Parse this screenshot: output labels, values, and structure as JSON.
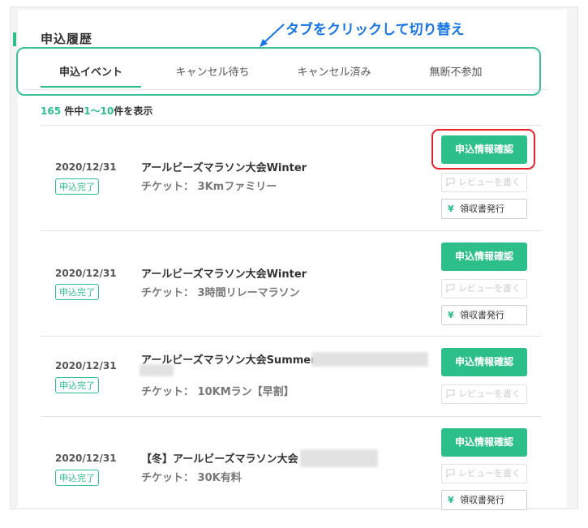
{
  "page": {
    "title": "申込履歴"
  },
  "annotation": {
    "text": "タブをクリックして切り替え",
    "color": "#1575e6"
  },
  "tabs": [
    {
      "label": "申込イベント",
      "active": true
    },
    {
      "label": "キャンセル待ち",
      "active": false
    },
    {
      "label": "キャンセル済み",
      "active": false
    },
    {
      "label": "無断不参加",
      "active": false
    }
  ],
  "count": {
    "total": "165",
    "suffix1": " 件中",
    "range_start": "1",
    "range_sep": "〜",
    "range_end": "10",
    "suffix2": "件を表示"
  },
  "theme": {
    "accent": "#2dbf89",
    "highlight_ring": "#e8202a"
  },
  "buttons": {
    "detail_label": "申込情報確認",
    "review_label": "レビューを書く",
    "receipt_label": "領収書発行",
    "review_icon": "speech-bubble-icon",
    "receipt_icon": "yen-icon"
  },
  "applications": [
    {
      "date": "2020/12/31",
      "status": "申込完了",
      "title": "アールビーズマラソン大会Winter",
      "ticket": "チケット： 3Kmファミリー",
      "has_receipt": true
    },
    {
      "date": "2020/12/31",
      "status": "申込完了",
      "title": "アールビーズマラソン大会Winter",
      "ticket": "チケット： 3時間リレーマラソン",
      "has_receipt": true
    },
    {
      "date": "2020/12/31",
      "status": "申込完了",
      "title": "アールビーズマラソン大会Summer",
      "ticket": "チケット： 10KMラン【早割】",
      "has_receipt": false
    },
    {
      "date": "2020/12/31",
      "status": "申込完了",
      "title": "【冬】アールビーズマラソン大会（",
      "ticket": "チケット： 30K有料",
      "has_receipt": true
    }
  ]
}
